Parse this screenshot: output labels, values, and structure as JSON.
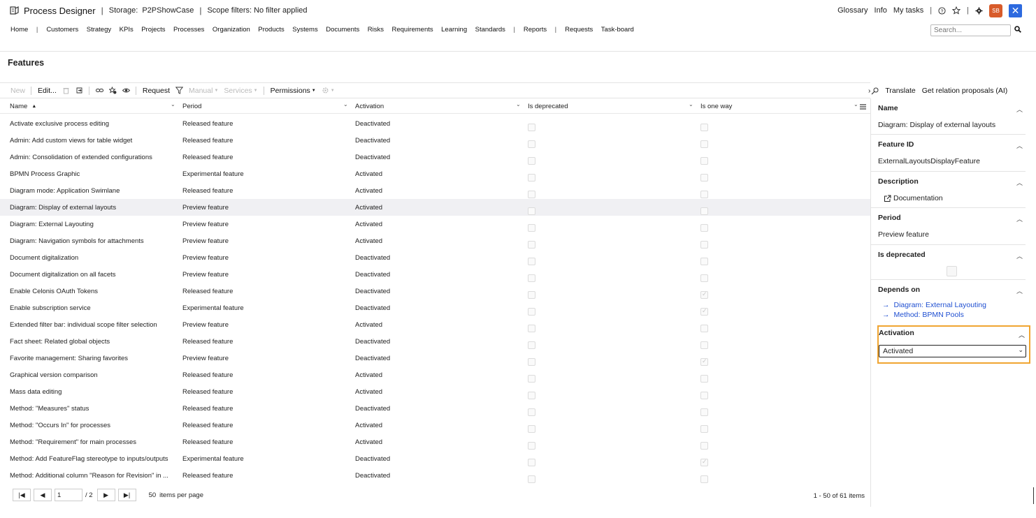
{
  "header": {
    "app_title": "Process Designer",
    "storage_label": "Storage:",
    "storage_value": "P2PShowCase",
    "scope_label": "Scope filters: No filter applied",
    "right_links": [
      "Glossary",
      "Info",
      "My tasks"
    ],
    "avatar_initials": "SB",
    "close_symbol": "✕"
  },
  "nav": {
    "home": "Home",
    "items_a": [
      "Customers",
      "Strategy",
      "KPIs",
      "Projects",
      "Processes",
      "Organization",
      "Products",
      "Systems",
      "Documents",
      "Risks",
      "Requirements",
      "Learning",
      "Standards"
    ],
    "reports": "Reports",
    "items_b": [
      "Requests",
      "Task-board"
    ],
    "search_placeholder": "Search..."
  },
  "page": {
    "title": "Features"
  },
  "toolbar": {
    "new": "New",
    "edit": "Edit...",
    "request": "Request",
    "manual": "Manual",
    "services": "Services",
    "permissions": "Permissions"
  },
  "grid": {
    "columns": [
      "Name",
      "Period",
      "Activation",
      "Is deprecated",
      "Is one way"
    ],
    "rows": [
      {
        "name": "Activate exclusive process editing",
        "period": "Released feature",
        "activation": "Deactivated",
        "deprecated": false,
        "one_way": false,
        "selected": false
      },
      {
        "name": "Admin: Add custom views for table widget",
        "period": "Released feature",
        "activation": "Deactivated",
        "deprecated": false,
        "one_way": false,
        "selected": false
      },
      {
        "name": "Admin: Consolidation of extended configurations",
        "period": "Released feature",
        "activation": "Deactivated",
        "deprecated": false,
        "one_way": false,
        "selected": false
      },
      {
        "name": "BPMN Process Graphic",
        "period": "Experimental feature",
        "activation": "Activated",
        "deprecated": false,
        "one_way": false,
        "selected": false
      },
      {
        "name": "Diagram mode: Application Swimlane",
        "period": "Released feature",
        "activation": "Activated",
        "deprecated": false,
        "one_way": false,
        "selected": false
      },
      {
        "name": "Diagram: Display of external layouts",
        "period": "Preview feature",
        "activation": "Activated",
        "deprecated": false,
        "one_way": false,
        "selected": true
      },
      {
        "name": "Diagram: External Layouting",
        "period": "Preview feature",
        "activation": "Activated",
        "deprecated": false,
        "one_way": false,
        "selected": false
      },
      {
        "name": "Diagram: Navigation symbols for attachments",
        "period": "Preview feature",
        "activation": "Activated",
        "deprecated": false,
        "one_way": false,
        "selected": false
      },
      {
        "name": "Document digitalization",
        "period": "Preview feature",
        "activation": "Deactivated",
        "deprecated": false,
        "one_way": false,
        "selected": false
      },
      {
        "name": "Document digitalization on all facets",
        "period": "Preview feature",
        "activation": "Deactivated",
        "deprecated": false,
        "one_way": false,
        "selected": false
      },
      {
        "name": "Enable Celonis OAuth Tokens",
        "period": "Released feature",
        "activation": "Deactivated",
        "deprecated": false,
        "one_way": true,
        "selected": false
      },
      {
        "name": "Enable subscription service",
        "period": "Experimental feature",
        "activation": "Deactivated",
        "deprecated": false,
        "one_way": true,
        "selected": false
      },
      {
        "name": "Extended filter bar: individual scope filter selection",
        "period": "Preview feature",
        "activation": "Activated",
        "deprecated": false,
        "one_way": false,
        "selected": false
      },
      {
        "name": "Fact sheet: Related global objects",
        "period": "Released feature",
        "activation": "Deactivated",
        "deprecated": false,
        "one_way": false,
        "selected": false
      },
      {
        "name": "Favorite management: Sharing favorites",
        "period": "Preview feature",
        "activation": "Deactivated",
        "deprecated": false,
        "one_way": true,
        "selected": false
      },
      {
        "name": "Graphical version comparison",
        "period": "Released feature",
        "activation": "Activated",
        "deprecated": false,
        "one_way": false,
        "selected": false
      },
      {
        "name": "Mass data editing",
        "period": "Released feature",
        "activation": "Activated",
        "deprecated": false,
        "one_way": false,
        "selected": false
      },
      {
        "name": "Method: \"Measures\" status",
        "period": "Released feature",
        "activation": "Deactivated",
        "deprecated": false,
        "one_way": false,
        "selected": false
      },
      {
        "name": "Method: \"Occurs In\" for processes",
        "period": "Released feature",
        "activation": "Activated",
        "deprecated": false,
        "one_way": false,
        "selected": false
      },
      {
        "name": "Method: \"Requirement\" for main processes",
        "period": "Released feature",
        "activation": "Activated",
        "deprecated": false,
        "one_way": false,
        "selected": false
      },
      {
        "name": "Method: Add FeatureFlag stereotype to inputs/outputs",
        "period": "Experimental feature",
        "activation": "Deactivated",
        "deprecated": false,
        "one_way": true,
        "selected": false
      },
      {
        "name": "Method: Additional column \"Reason for Revision\" in ...",
        "period": "Released feature",
        "activation": "Deactivated",
        "deprecated": false,
        "one_way": false,
        "selected": false
      }
    ]
  },
  "pager": {
    "page": "1",
    "of_pages": "/ 2",
    "per_page": "50",
    "per_page_label": "items per page",
    "count": "1 - 50 of 61 items"
  },
  "panel": {
    "translate": "Translate",
    "relation": "Get relation proposals (AI)",
    "name_title": "Name",
    "name_value": "Diagram: Display of external layouts",
    "id_title": "Feature ID",
    "id_value": "ExternalLayoutsDisplayFeature",
    "desc_title": "Description",
    "desc_link": "Documentation",
    "period_title": "Period",
    "period_value": "Preview feature",
    "deprecated_title": "Is deprecated",
    "depends_title": "Depends on",
    "depends": [
      "Diagram: External Layouting",
      "Method: BPMN Pools"
    ],
    "activation_title": "Activation",
    "activation_value": "Activated"
  }
}
